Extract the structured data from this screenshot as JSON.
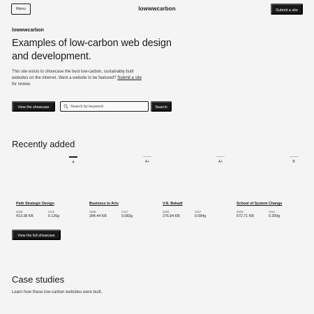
{
  "header": {
    "menu_label": "Menu",
    "logo": "lowwwcarbon",
    "submit_label": "Submit a site"
  },
  "hero": {
    "brand": "lowwwcarbon",
    "title": "Examples of low-carbon web design and development.",
    "text": "This site exists to showcase the best low-carbon, sustainably built websites on the internet. Want a website to be featured?",
    "submit_link": "Submit a site",
    "submit_suffix": " for review.",
    "view_showcase_label": "View the showcase",
    "search_placeholder": "Search by keyword",
    "search_button_label": "Search"
  },
  "recent": {
    "title": "Recently added",
    "filters": [
      {
        "label": "A",
        "active": true
      },
      {
        "label": "A+",
        "active": false
      },
      {
        "label": "A+",
        "active": false
      },
      {
        "label": "B",
        "active": false
      }
    ],
    "stat_labels": {
      "size": "SIZE",
      "co2": "CO2"
    },
    "cards": [
      {
        "title": "Path Strategic Design",
        "size": "413.38 KB",
        "co2": "0.126g"
      },
      {
        "title": "Business to Arts",
        "size": "284.44 KB",
        "co2": "0.082g"
      },
      {
        "title": "V.N. Bekadi",
        "size": "276.84 KB",
        "co2": "0.084g"
      },
      {
        "title": "School of System Change",
        "size": "672.71 KB",
        "co2": "0.209g"
      }
    ],
    "full_showcase_label": "View the full showcase"
  },
  "case_studies": {
    "title": "Case studies",
    "text": "Learn how these low-carbon websites were built."
  }
}
